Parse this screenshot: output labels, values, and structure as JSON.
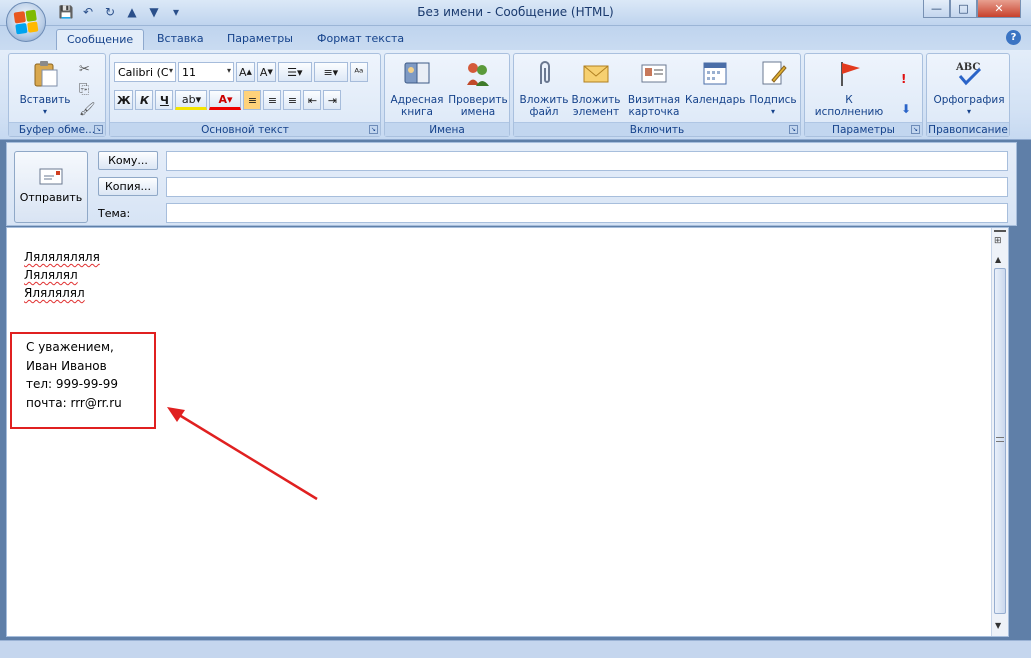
{
  "window": {
    "title": "Без имени - Сообщение (HTML)",
    "controls": {
      "minimize": "—",
      "maximize": "□",
      "close": "✕"
    }
  },
  "qat": [
    "save-icon",
    "undo-icon",
    "redo-icon",
    "up-icon",
    "down-icon",
    "customize-icon"
  ],
  "tabs": [
    {
      "label": "Сообщение",
      "active": true
    },
    {
      "label": "Вставка",
      "active": false
    },
    {
      "label": "Параметры",
      "active": false
    },
    {
      "label": "Формат текста",
      "active": false
    }
  ],
  "ribbon": {
    "clipboard": {
      "label": "Буфер обме...",
      "paste": "Вставить"
    },
    "basic_text": {
      "label": "Основной текст",
      "font": "Calibri (С",
      "size": "11"
    },
    "names": {
      "label": "Имена",
      "address_book": "Адресная\nкнига",
      "check_names": "Проверить\nимена"
    },
    "include": {
      "label": "Включить",
      "attach_file": "Вложить\nфайл",
      "attach_item": "Вложить\nэлемент",
      "business_card": "Визитная\nкарточка",
      "calendar": "Календарь",
      "signature": "Подпись"
    },
    "options": {
      "label": "Параметры",
      "follow_up": "К\nисполнению"
    },
    "proofing": {
      "label": "Правописание",
      "spelling": "Орфография"
    }
  },
  "header": {
    "send": "Отправить",
    "to_label": "Кому...",
    "cc_label": "Копия...",
    "subject_label": "Тема:",
    "to_value": "",
    "cc_value": "",
    "subject_value": ""
  },
  "body": {
    "lines": [
      "Ляляляляля",
      "Лялялял",
      "Ялялялял"
    ],
    "signature": [
      "С уважением,",
      "Иван Иванов",
      "тел: 999-99-99",
      "почта: rrr@rr.ru"
    ]
  },
  "colors": {
    "annotation": "#e02020",
    "ribbon": "#dce8f7"
  }
}
